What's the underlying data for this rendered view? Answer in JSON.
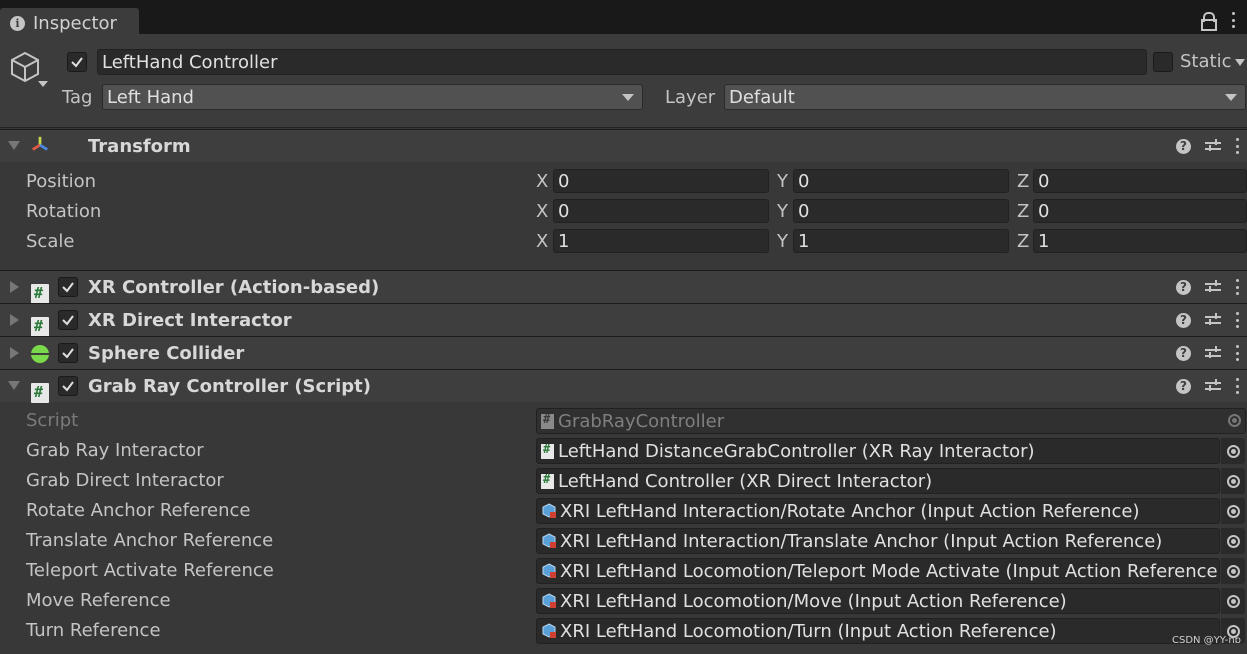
{
  "window": {
    "tab_label": "Inspector"
  },
  "header": {
    "object_name": "LeftHand Controller",
    "static_label": "Static",
    "tag_label": "Tag",
    "tag_value": "Left Hand",
    "layer_label": "Layer",
    "layer_value": "Default"
  },
  "transform": {
    "title": "Transform",
    "rows": [
      {
        "label": "Position",
        "x": "0",
        "y": "0",
        "z": "0"
      },
      {
        "label": "Rotation",
        "x": "0",
        "y": "0",
        "z": "0"
      },
      {
        "label": "Scale",
        "x": "1",
        "y": "1",
        "z": "1"
      }
    ],
    "axes": {
      "x": "X",
      "y": "Y",
      "z": "Z"
    }
  },
  "components": [
    {
      "title": "XR Controller (Action-based)"
    },
    {
      "title": "XR Direct Interactor"
    },
    {
      "title": "Sphere Collider"
    },
    {
      "title": "Grab Ray Controller (Script)"
    }
  ],
  "grab_ray": {
    "properties": [
      {
        "label": "Script",
        "value": "GrabRayController"
      },
      {
        "label": "Grab Ray Interactor",
        "value": "LeftHand DistanceGrabController (XR Ray Interactor)"
      },
      {
        "label": "Grab Direct Interactor",
        "value": "LeftHand Controller (XR Direct Interactor)"
      },
      {
        "label": "Rotate Anchor Reference",
        "value": "XRI LeftHand Interaction/Rotate Anchor (Input Action Reference)"
      },
      {
        "label": "Translate Anchor Reference",
        "value": "XRI LeftHand Interaction/Translate Anchor (Input Action Reference)"
      },
      {
        "label": "Teleport Activate Reference",
        "value": "XRI LeftHand Locomotion/Teleport Mode Activate (Input Action Reference)"
      },
      {
        "label": "Move Reference",
        "value": "XRI LeftHand Locomotion/Move (Input Action Reference)"
      },
      {
        "label": "Turn Reference",
        "value": "XRI LeftHand Locomotion/Turn (Input Action Reference)"
      }
    ]
  },
  "watermark": "CSDN @YY-nb"
}
